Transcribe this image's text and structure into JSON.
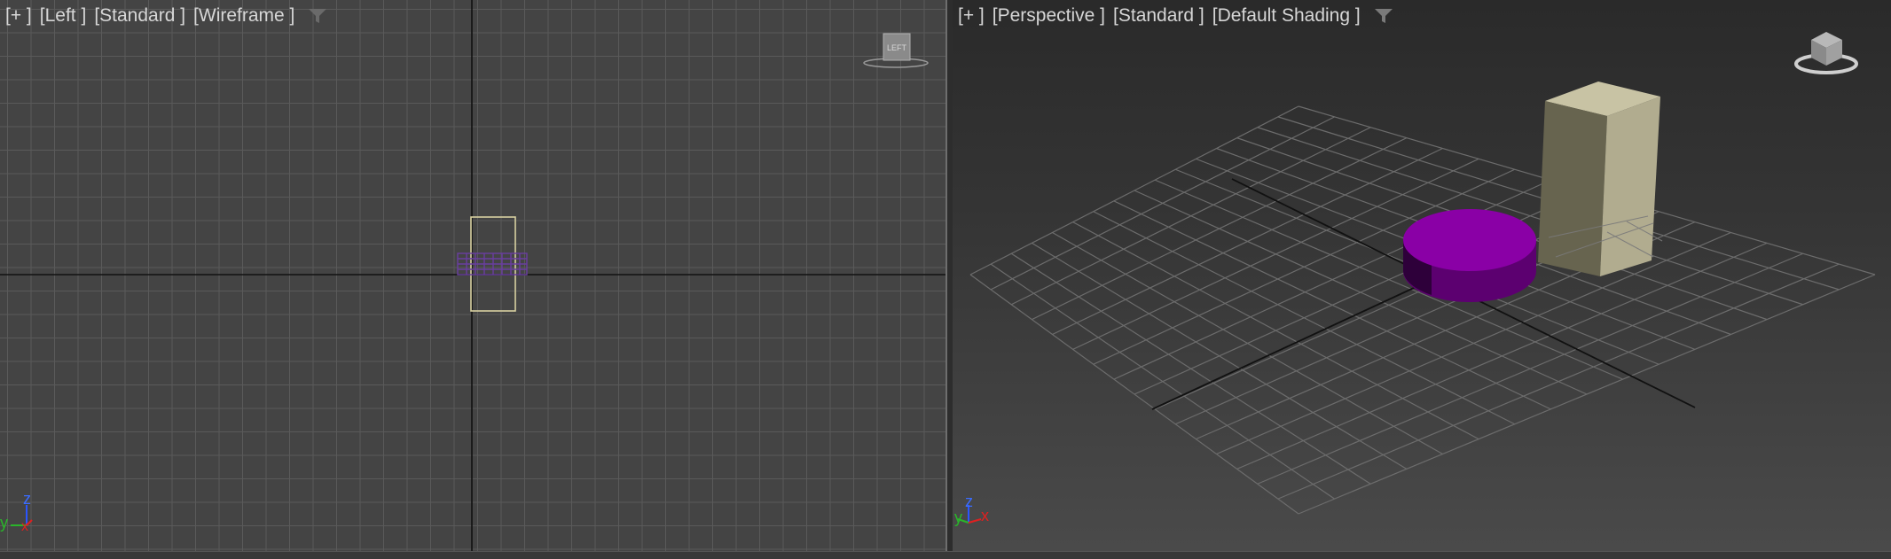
{
  "viewports": {
    "left": {
      "labels": [
        "[+ ]",
        "[Left ]",
        "[Standard ]",
        "[Wireframe ]"
      ],
      "viewcube_text": "LEFT"
    },
    "perspective": {
      "labels": [
        "[+ ]",
        "[Perspective ]",
        "[Standard ]",
        "[Default Shading ]"
      ]
    }
  },
  "axis_labels": {
    "y": "y",
    "z": "z",
    "x": "x"
  },
  "colors": {
    "cylinder": "#8a00a6",
    "box": "#b5b092",
    "wire_purple": "#6a3ea0",
    "wire_box": "#d8d0a0"
  }
}
